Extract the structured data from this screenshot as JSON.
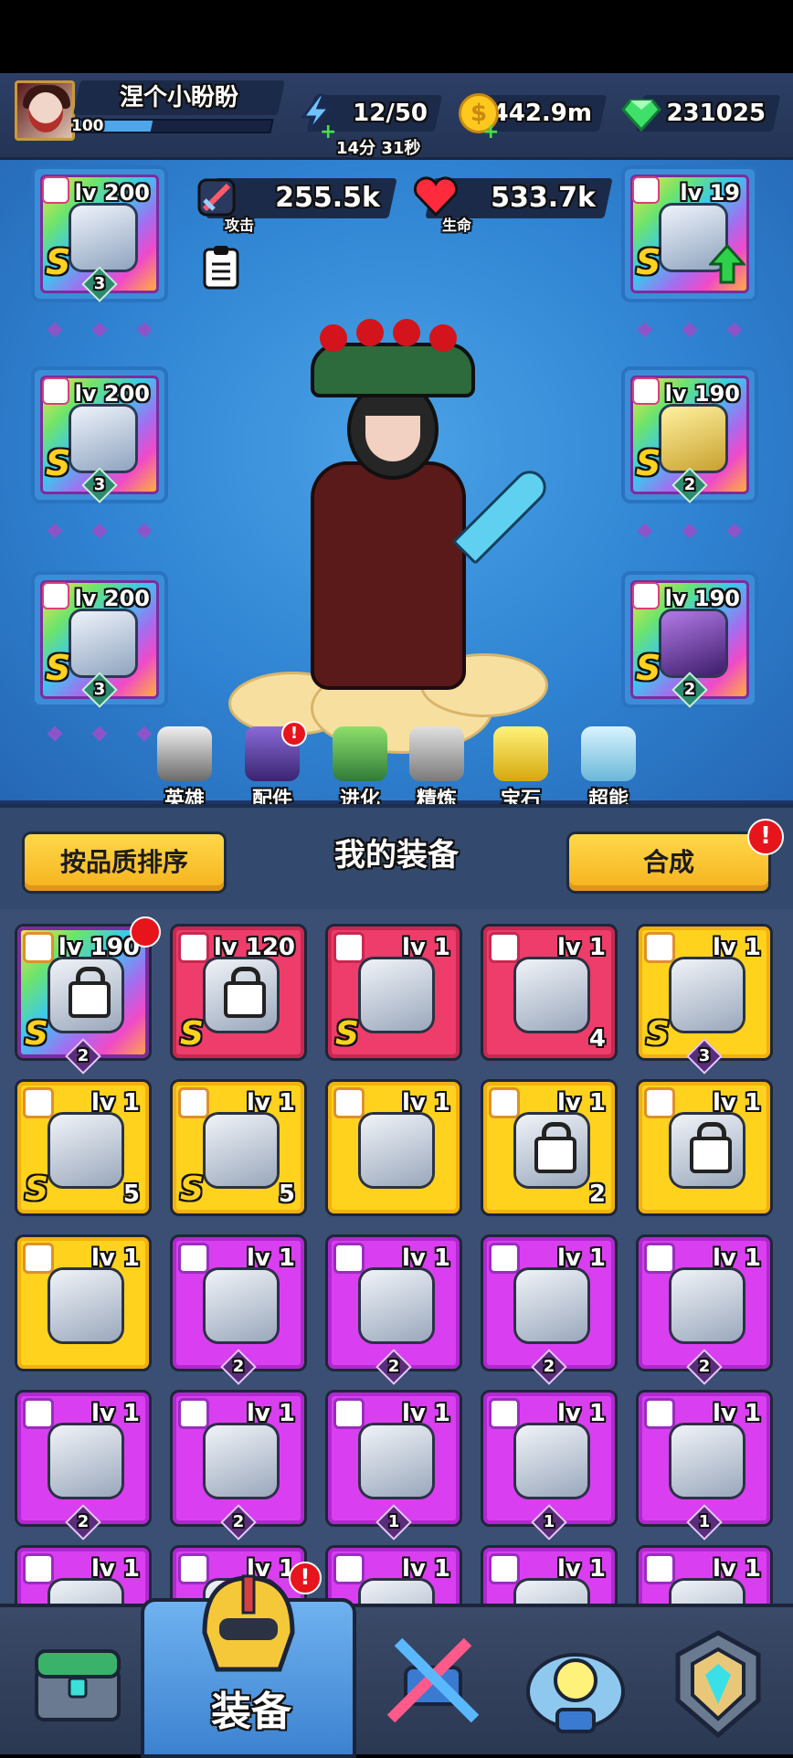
{
  "player": {
    "name": "涅个小盼盼",
    "level": "100",
    "xp_fraction": 0.38
  },
  "resources": {
    "energy": "12/50",
    "energy_timer": "14分 31秒",
    "gold": "442.9m",
    "gems": "231025"
  },
  "stats": {
    "attack_value": "255.5k",
    "attack_label": "攻击",
    "health_value": "533.7k",
    "health_label": "生命"
  },
  "equipped": [
    {
      "slot": "weapon",
      "level": "lv 200",
      "grade": "S",
      "stars": "3"
    },
    {
      "slot": "helmet",
      "level": "lv 200",
      "grade": "S",
      "stars": "3"
    },
    {
      "slot": "gloves",
      "level": "lv 200",
      "grade": "S",
      "stars": "3"
    },
    {
      "slot": "armor",
      "level": "lv 19",
      "grade": "S",
      "stars": ""
    },
    {
      "slot": "ring",
      "level": "lv 190",
      "grade": "S",
      "stars": "2"
    },
    {
      "slot": "boots",
      "level": "lv 190",
      "grade": "S",
      "stars": "2"
    }
  ],
  "subnav": [
    {
      "label": "英雄",
      "icon": "hero-icon"
    },
    {
      "label": "配件",
      "icon": "accessory-icon",
      "badge": "!"
    },
    {
      "label": "进化",
      "icon": "evolve-icon"
    },
    {
      "label": "精炼",
      "icon": "refine-icon"
    },
    {
      "label": "宝石",
      "icon": "gem-icon"
    },
    {
      "label": "超能",
      "icon": "superpower-icon"
    }
  ],
  "equipment_header": {
    "sort_button": "按品质排序",
    "title": "我的装备",
    "merge_button": "合成",
    "merge_badge": "!"
  },
  "inventory": [
    {
      "color": "rainbow",
      "level": "lv 190",
      "grade": "S",
      "stars": "2",
      "count": "",
      "locked": true
    },
    {
      "color": "red",
      "level": "lv 120",
      "grade": "S",
      "stars": "",
      "count": "",
      "locked": true
    },
    {
      "color": "red",
      "level": "lv 1",
      "grade": "S",
      "stars": "",
      "count": "",
      "locked": false
    },
    {
      "color": "red",
      "level": "lv 1",
      "grade": "",
      "stars": "",
      "count": "4",
      "locked": false
    },
    {
      "color": "yellow",
      "level": "lv 1",
      "grade": "S",
      "stars": "3",
      "count": "",
      "locked": false
    },
    {
      "color": "yellow",
      "level": "lv 1",
      "grade": "S",
      "stars": "",
      "count": "5",
      "locked": false
    },
    {
      "color": "yellow",
      "level": "lv 1",
      "grade": "S",
      "stars": "",
      "count": "5",
      "locked": false
    },
    {
      "color": "yellow",
      "level": "lv 1",
      "grade": "",
      "stars": "",
      "count": "",
      "locked": false
    },
    {
      "color": "yellow",
      "level": "lv 1",
      "grade": "",
      "stars": "",
      "count": "2",
      "locked": true
    },
    {
      "color": "yellow",
      "level": "lv 1",
      "grade": "",
      "stars": "",
      "count": "",
      "locked": true
    },
    {
      "color": "yellow",
      "level": "lv 1",
      "grade": "",
      "stars": "",
      "count": "",
      "locked": false
    },
    {
      "color": "purple",
      "level": "lv 1",
      "grade": "",
      "stars": "2",
      "count": "",
      "locked": false
    },
    {
      "color": "purple",
      "level": "lv 1",
      "grade": "",
      "stars": "2",
      "count": "",
      "locked": false
    },
    {
      "color": "purple",
      "level": "lv 1",
      "grade": "",
      "stars": "2",
      "count": "",
      "locked": false
    },
    {
      "color": "purple",
      "level": "lv 1",
      "grade": "",
      "stars": "2",
      "count": "",
      "locked": false
    },
    {
      "color": "purple",
      "level": "lv 1",
      "grade": "",
      "stars": "2",
      "count": "",
      "locked": false
    },
    {
      "color": "purple",
      "level": "lv 1",
      "grade": "",
      "stars": "2",
      "count": "",
      "locked": false
    },
    {
      "color": "purple",
      "level": "lv 1",
      "grade": "",
      "stars": "1",
      "count": "",
      "locked": false
    },
    {
      "color": "purple",
      "level": "lv 1",
      "grade": "",
      "stars": "1",
      "count": "",
      "locked": false
    },
    {
      "color": "purple",
      "level": "lv 1",
      "grade": "",
      "stars": "1",
      "count": "",
      "locked": false
    },
    {
      "color": "purple",
      "level": "lv 1",
      "grade": "",
      "stars": "",
      "count": "",
      "locked": false
    },
    {
      "color": "purple",
      "level": "lv 1",
      "grade": "",
      "stars": "",
      "count": "",
      "locked": false
    },
    {
      "color": "purple",
      "level": "lv 1",
      "grade": "",
      "stars": "",
      "count": "",
      "locked": false
    },
    {
      "color": "purple",
      "level": "lv 1",
      "grade": "",
      "stars": "",
      "count": "",
      "locked": false
    },
    {
      "color": "purple",
      "level": "lv 1",
      "grade": "",
      "stars": "",
      "count": "",
      "locked": false
    }
  ],
  "bottom_nav": [
    {
      "icon": "treasure-chest-icon",
      "label": "",
      "active": false
    },
    {
      "icon": "equipment-helmet-icon",
      "label": "装备",
      "active": true,
      "badge": "!"
    },
    {
      "icon": "crossed-swords-icon",
      "label": "",
      "active": false
    },
    {
      "icon": "robot-pod-icon",
      "label": "",
      "active": false
    },
    {
      "icon": "rank-emblem-icon",
      "label": "",
      "active": false
    }
  ],
  "colors": {
    "yellow": "#ffd21e",
    "purple": "#d93ff0",
    "red": "#ee3d6a",
    "accent": "#ffd84a",
    "badge": "#e8141c"
  }
}
